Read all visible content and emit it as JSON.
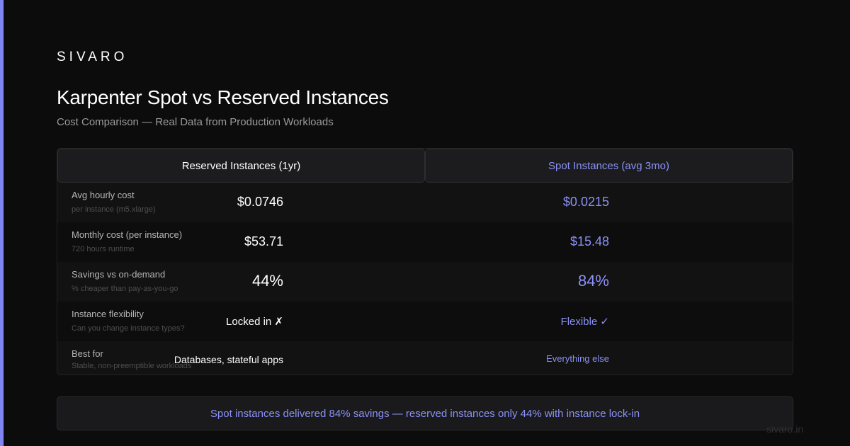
{
  "brand": "SIVARO",
  "title": "Karpenter Spot vs Reserved Instances",
  "subtitle": "Cost Comparison — Real Data from Production Workloads",
  "colors": {
    "accent": "#7f86f4",
    "spot": "#8b91f6",
    "background": "#0c0c0c"
  },
  "table": {
    "headers": {
      "reserved": "Reserved Instances (1yr)",
      "spot": "Spot Instances (avg 3mo)"
    },
    "rows": [
      {
        "label": "Avg hourly cost",
        "sublabel": "per instance (m5.xlarge)",
        "reserved": "$0.0746",
        "spot": "$0.0215"
      },
      {
        "label": "Monthly cost (per instance)",
        "sublabel": "720 hours runtime",
        "reserved": "$53.71",
        "spot": "$15.48"
      },
      {
        "label": "Savings vs on-demand",
        "sublabel": "% cheaper than pay-as-you-go",
        "reserved": "44%",
        "spot": "84%"
      },
      {
        "label": "Instance flexibility",
        "sublabel": "Can you change instance types?",
        "reserved": "Locked in ✗",
        "spot": "Flexible ✓"
      },
      {
        "label": "Best for",
        "sublabel": "Stable, non-preemptible workloads",
        "reserved": "Databases, stateful apps",
        "spot": "Everything else"
      }
    ]
  },
  "callout": "Spot instances delivered 84% savings — reserved instances only 44% with instance lock-in",
  "watermark": "sivaro.in"
}
